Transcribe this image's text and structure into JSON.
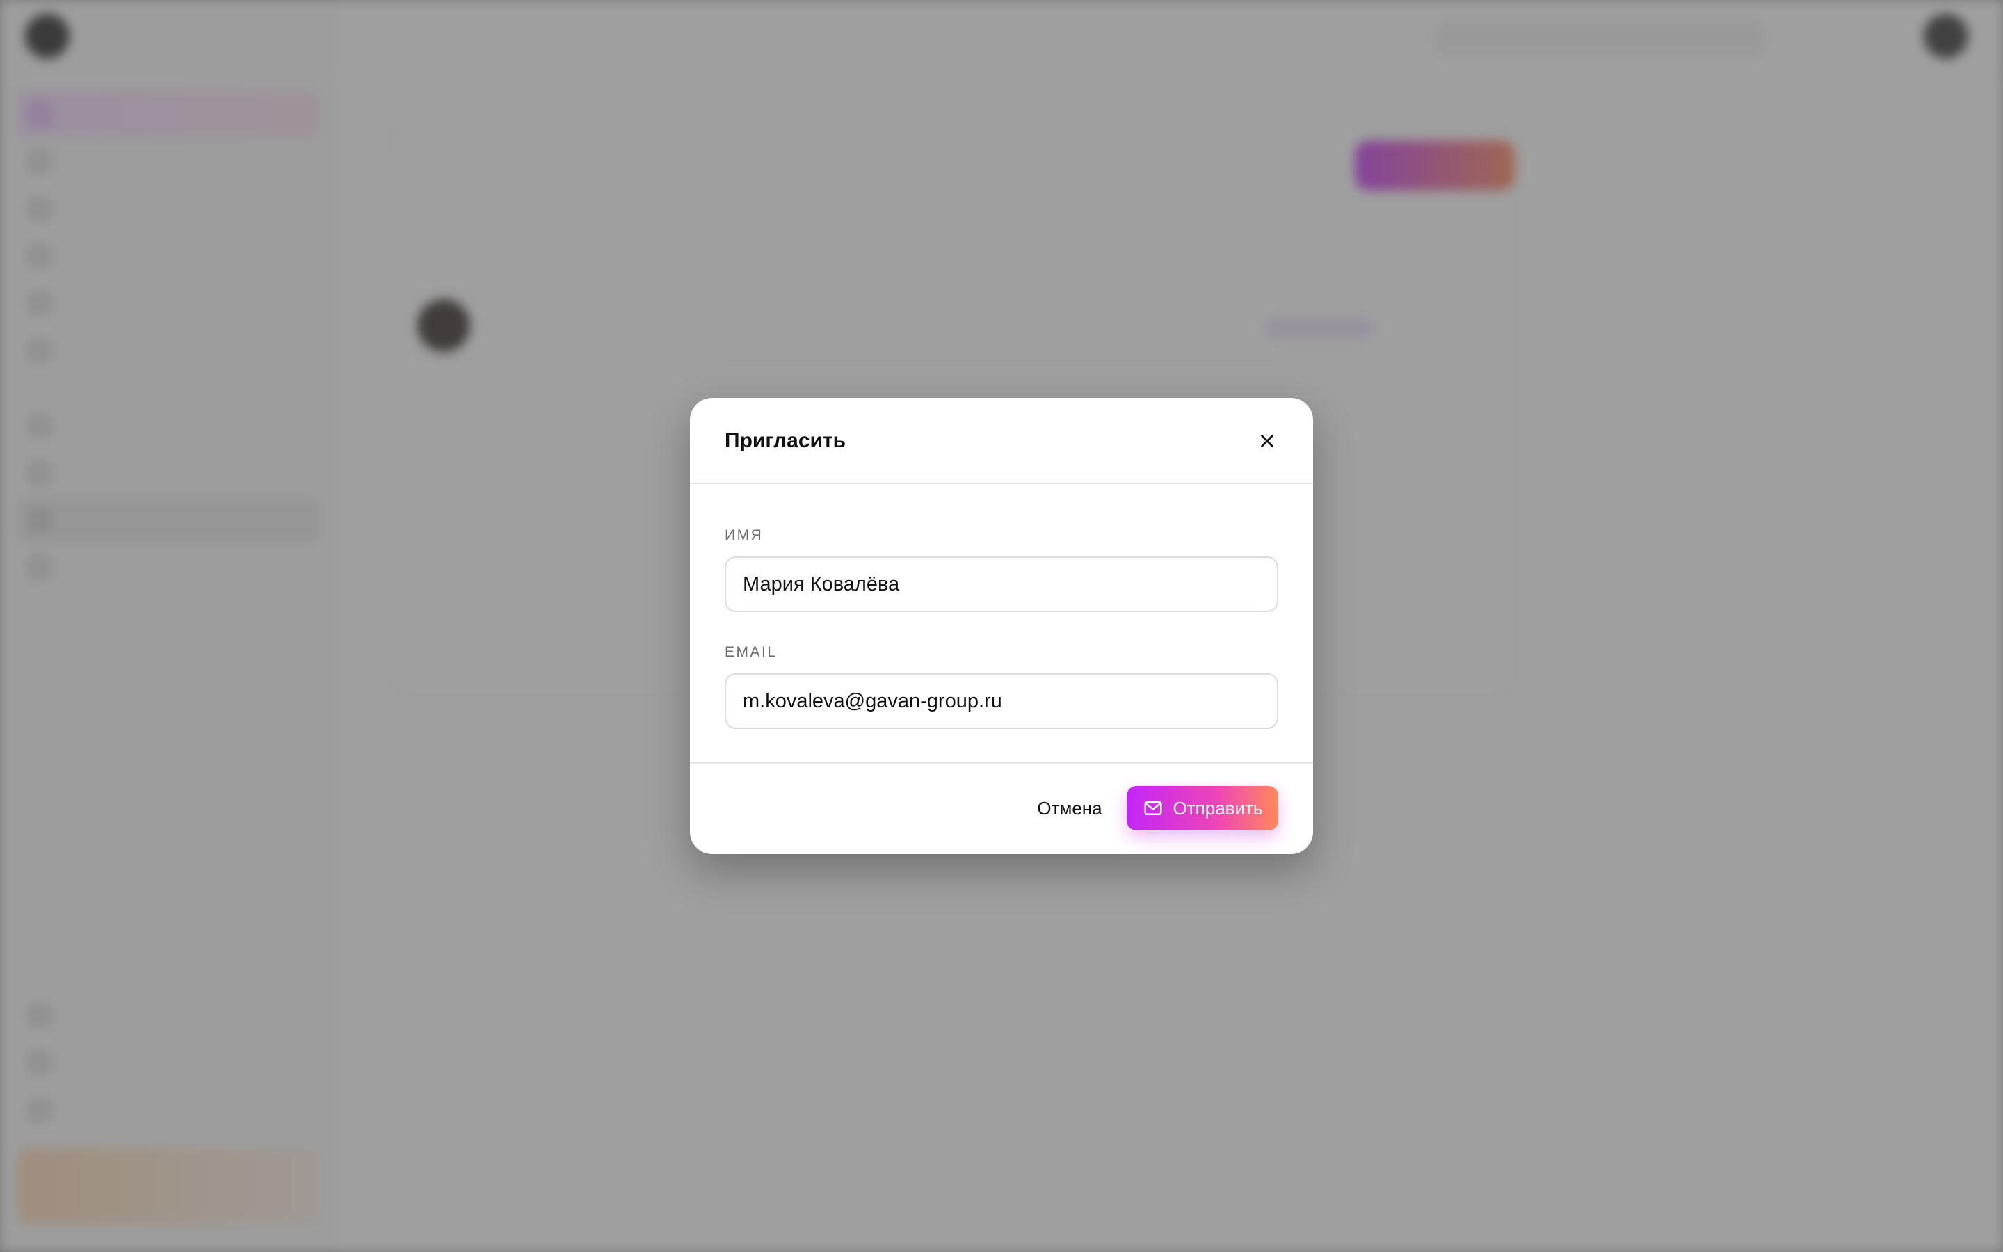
{
  "modal": {
    "title": "Пригласить",
    "name_label": "ИМЯ",
    "name_value": "Мария Ковалёва",
    "email_label": "EMAIL",
    "email_value": "m.kovaleva@gavan-group.ru",
    "cancel_label": "Отмена",
    "submit_label": "Отправить",
    "close_icon": "close-icon",
    "submit_icon": "mail-icon"
  },
  "colors": {
    "accent_start": "#c226f7",
    "accent_end": "#ff8a5a",
    "overlay": "#5a5a5a"
  }
}
